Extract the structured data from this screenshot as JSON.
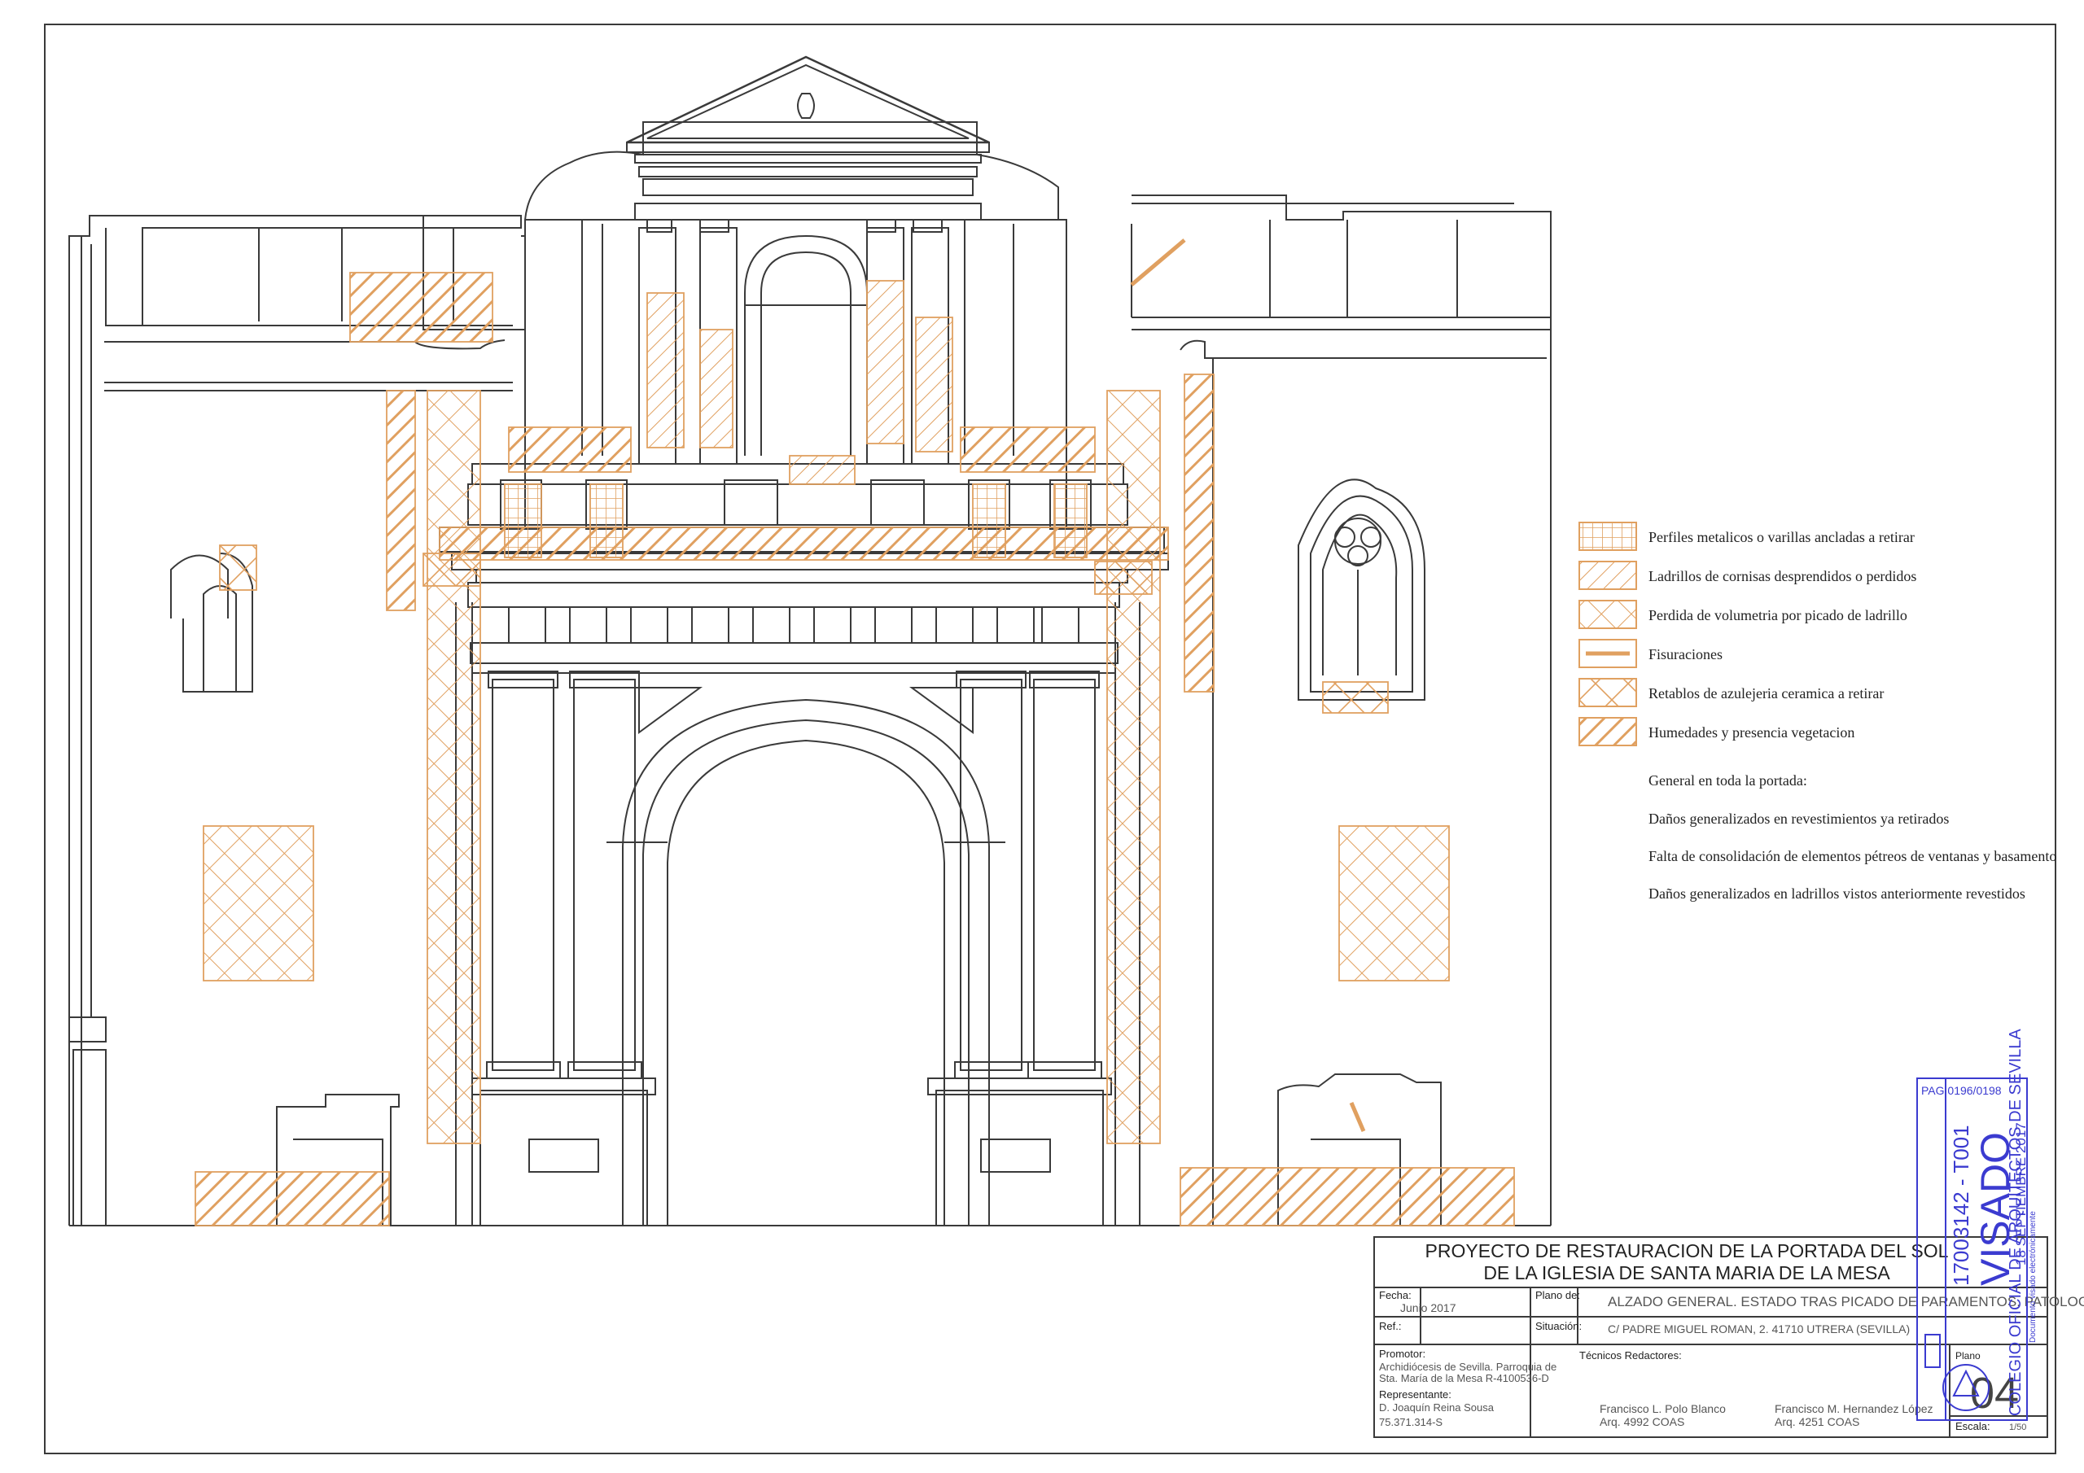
{
  "legend": {
    "items": [
      {
        "key": "metal",
        "label": "Perfiles metalicos o varillas ancladas a retirar",
        "pattern": "grid"
      },
      {
        "key": "cornice",
        "label": "Ladrillos de cornisas desprendidos o perdidos",
        "pattern": "thin-diagonal"
      },
      {
        "key": "volume",
        "label": "Perdida de volumetria por picado de ladrillo",
        "pattern": "cross"
      },
      {
        "key": "cracks",
        "label": "Fisuraciones",
        "pattern": "line"
      },
      {
        "key": "tiles",
        "label": "Retablos de azulejeria ceramica a retirar",
        "pattern": "x"
      },
      {
        "key": "damp",
        "label": "Humedades y presencia vegetacion",
        "pattern": "thick-diagonal"
      }
    ],
    "general_title": "General en toda la portada:",
    "general_notes": [
      "Daños generalizados en revestimientos ya retirados",
      "Falta de consolidación de elementos pétreos de ventanas y basamento",
      "Daños generalizados en ladrillos vistos anteriormente revestidos"
    ]
  },
  "title_block": {
    "project_line1": "PROYECTO DE RESTAURACION DE LA PORTADA DEL SOL",
    "project_line2": "DE LA IGLESIA DE SANTA MARIA DE LA MESA",
    "fecha_label": "Fecha:",
    "fecha_value": "Junio 2017",
    "plano_label": "Plano de:",
    "plano_value": "ALZADO GENERAL. ESTADO TRAS PICADO DE PARAMENTOS. PATOLOGIAS",
    "ref_label": "Ref.:",
    "situacion_label": "Situación:",
    "situacion_value": "C/ PADRE MIGUEL ROMAN, 2.  41710 UTRERA (SEVILLA)",
    "promotor_label": "Promotor:",
    "promotor_line1": "Archidiócesis de Sevilla. Parroquia de",
    "promotor_line2": "Sta. María de la Mesa  R-4100536-D",
    "representante_label": "Representante:",
    "representante_name": "D. Joaquín Reina Sousa",
    "representante_id": "75.371.314-S",
    "tecnicos_label": "Técnicos Redactores:",
    "tecnico1_name": "Francisco L. Polo Blanco",
    "tecnico1_arq": "Arq. 4992 COAS",
    "tecnico2_name": "Francisco M. Hernandez López",
    "tecnico2_arq": "Arq. 4251 COAS",
    "plano_n_label": "Plano",
    "plano_number": "04",
    "escala_label": "Escala:",
    "escala_value": "1/50"
  },
  "stamp": {
    "pag": "PAG 0196/0198",
    "code": "17003142 - T001",
    "visado": "VISADO",
    "date": "18  SEPTIEMBRE  2017",
    "college": "COLEGIO OFICIAL DE ARQUITECTOS DE SEVILLA",
    "note": "Documento visado electrónicamente"
  },
  "colors": {
    "line": "#3a3a3a",
    "hatch": "#e0a060",
    "stamp": "#3b3bd0"
  }
}
